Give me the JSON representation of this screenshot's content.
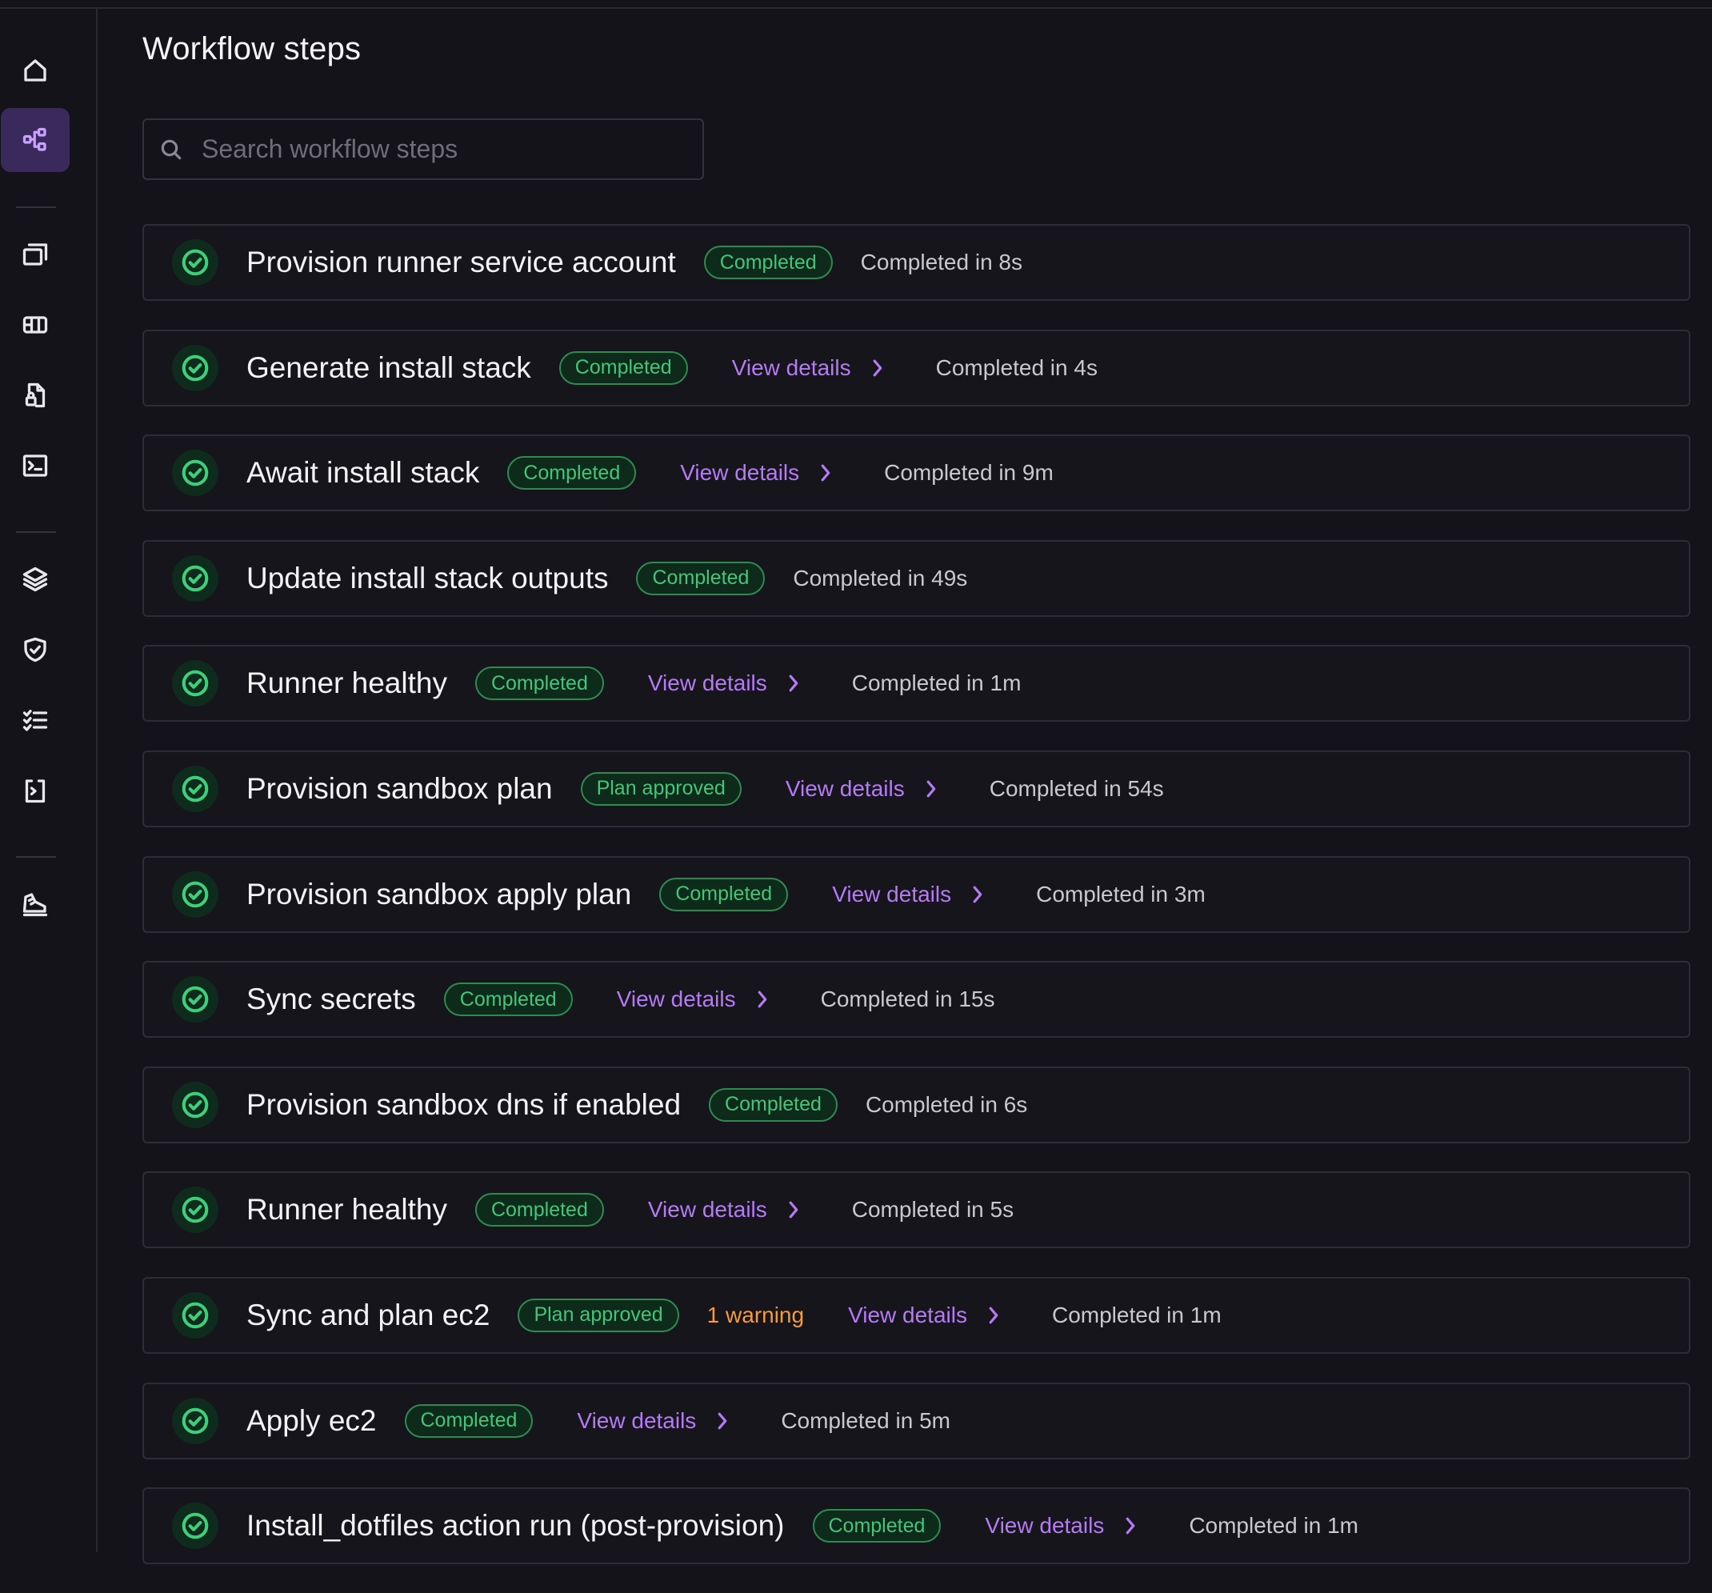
{
  "page": {
    "title": "Workflow steps"
  },
  "search": {
    "placeholder": "Search workflow steps",
    "value": ""
  },
  "sidebar": {
    "items": [
      {
        "icon": "home-icon",
        "active": false
      },
      {
        "icon": "workflow-icon",
        "active": true
      },
      {
        "icon": "windows-stack-icon",
        "active": false
      },
      {
        "icon": "components-icon",
        "active": false
      },
      {
        "icon": "file-lock-icon",
        "active": false
      },
      {
        "icon": "terminal-icon",
        "active": false
      },
      {
        "icon": "layers-icon",
        "active": false
      },
      {
        "icon": "shield-check-icon",
        "active": false
      },
      {
        "icon": "list-checks-icon",
        "active": false
      },
      {
        "icon": "clipboard-arrow-icon",
        "active": false
      },
      {
        "icon": "sneaker-icon",
        "active": false
      }
    ]
  },
  "colors": {
    "background": "#141319",
    "accent": "#b57bf5",
    "success": "#45c57a",
    "warning": "#f59a3d"
  },
  "steps": [
    {
      "name": "Provision runner service account",
      "status": "Completed",
      "details": "",
      "warning": "",
      "duration": "Completed in 8s"
    },
    {
      "name": "Generate install stack",
      "status": "Completed",
      "details": "View details",
      "warning": "",
      "duration": "Completed in 4s"
    },
    {
      "name": "Await install stack",
      "status": "Completed",
      "details": "View details",
      "warning": "",
      "duration": "Completed in 9m"
    },
    {
      "name": "Update install stack outputs",
      "status": "Completed",
      "details": "",
      "warning": "",
      "duration": "Completed in 49s"
    },
    {
      "name": "Runner healthy",
      "status": "Completed",
      "details": "View details",
      "warning": "",
      "duration": "Completed in 1m"
    },
    {
      "name": "Provision sandbox plan",
      "status": "Plan approved",
      "details": "View details",
      "warning": "",
      "duration": "Completed in 54s"
    },
    {
      "name": "Provision sandbox apply plan",
      "status": "Completed",
      "details": "View details",
      "warning": "",
      "duration": "Completed in 3m"
    },
    {
      "name": "Sync secrets",
      "status": "Completed",
      "details": "View details",
      "warning": "",
      "duration": "Completed in 15s"
    },
    {
      "name": "Provision sandbox dns if enabled",
      "status": "Completed",
      "details": "",
      "warning": "",
      "duration": "Completed in 6s"
    },
    {
      "name": "Runner healthy",
      "status": "Completed",
      "details": "View details",
      "warning": "",
      "duration": "Completed in 5s"
    },
    {
      "name": "Sync and plan ec2",
      "status": "Plan approved",
      "details": "View details",
      "warning": "1 warning",
      "duration": "Completed in 1m"
    },
    {
      "name": "Apply ec2",
      "status": "Completed",
      "details": "View details",
      "warning": "",
      "duration": "Completed in 5m"
    },
    {
      "name": "Install_dotfiles action run (post-provision)",
      "status": "Completed",
      "details": "View details",
      "warning": "",
      "duration": "Completed in 1m"
    }
  ]
}
